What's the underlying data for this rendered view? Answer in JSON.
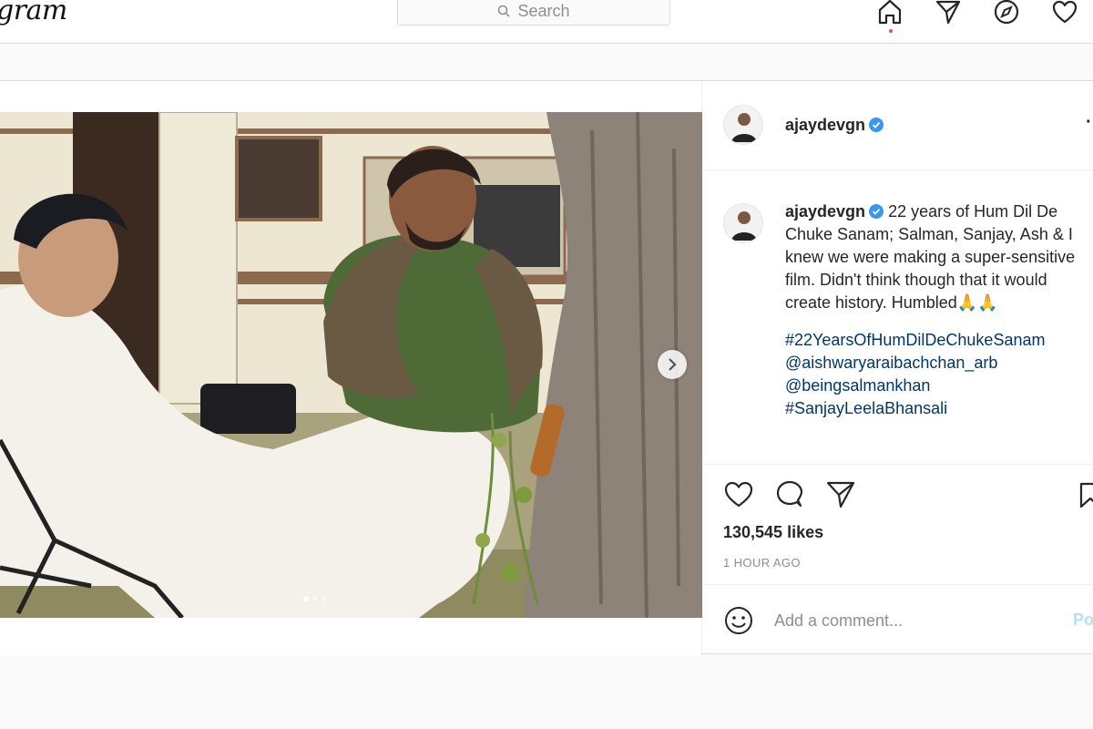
{
  "app": {
    "logo_text": "gram"
  },
  "search": {
    "placeholder": "Search"
  },
  "nav": {
    "icons": [
      "home-icon",
      "direct-icon",
      "explore-icon",
      "activity-icon"
    ]
  },
  "post": {
    "username": "ajaydevgn",
    "caption": "22 years of Hum Dil De Chuke Sanam; Salman, Sanjay, Ash & I knew we were making a super-sensitive film. Didn't think though that it would create history. Humbled🙏🙏",
    "hashtags": [
      "#22YearsOfHumDilDeChukeSanam",
      "@aishwaryaraibachchan_arb",
      "@beingsalmankhan",
      "#SanjayLeelaBhansali"
    ],
    "likes": "130,545 likes",
    "time": "1 HOUR AGO",
    "more": "·",
    "carousel": {
      "slides": 3,
      "current": 1
    }
  },
  "comment": {
    "placeholder": "Add a comment...",
    "post_label": "Po"
  },
  "colors": {
    "accent": "#0095f6",
    "link": "#00376b",
    "muted": "#8e8e8e",
    "border": "#dbdbdb"
  }
}
